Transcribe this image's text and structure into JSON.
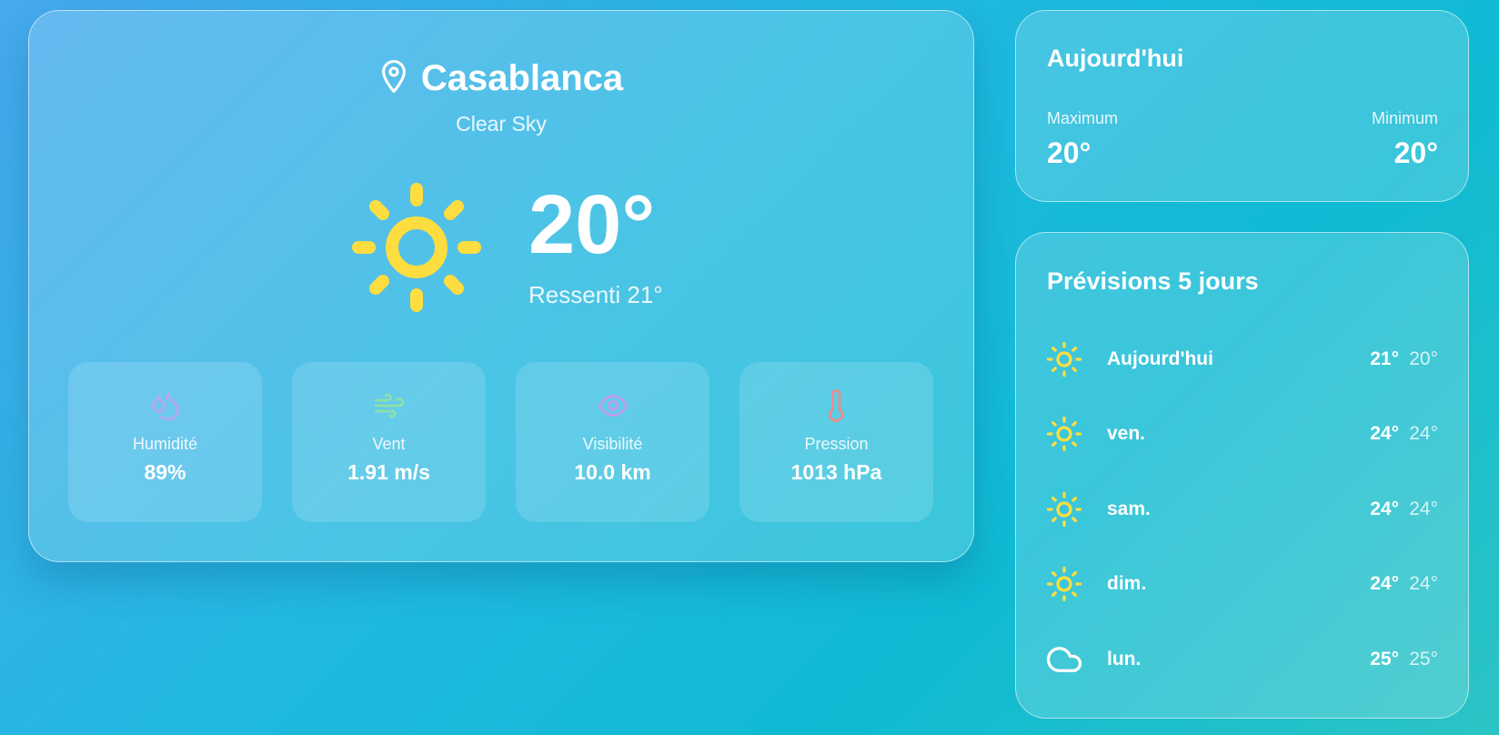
{
  "current": {
    "city": "Casablanca",
    "description": "Clear Sky",
    "temperature": "20°",
    "feels_like": "Ressenti 21°",
    "icon": "sun-icon",
    "stats": [
      {
        "icon": "droplets-icon",
        "color": "#b9a7f0",
        "label": "Humidité",
        "value": "89%"
      },
      {
        "icon": "wind-icon",
        "color": "#8de0a8",
        "label": "Vent",
        "value": "1.91 m/s"
      },
      {
        "icon": "eye-icon",
        "color": "#c39af2",
        "label": "Visibilité",
        "value": "10.0 km"
      },
      {
        "icon": "thermometer-icon",
        "color": "#f08a8a",
        "label": "Pression",
        "value": "1013 hPa"
      }
    ]
  },
  "today": {
    "title": "Aujourd'hui",
    "max_label": "Maximum",
    "max_value": "20°",
    "min_label": "Minimum",
    "min_value": "20°"
  },
  "forecast": {
    "title": "Prévisions 5 jours",
    "days": [
      {
        "icon": "sun-icon",
        "day": "Aujourd'hui",
        "high": "21°",
        "low": "20°"
      },
      {
        "icon": "sun-icon",
        "day": "ven.",
        "high": "24°",
        "low": "24°"
      },
      {
        "icon": "sun-icon",
        "day": "sam.",
        "high": "24°",
        "low": "24°"
      },
      {
        "icon": "sun-icon",
        "day": "dim.",
        "high": "24°",
        "low": "24°"
      },
      {
        "icon": "cloud-icon",
        "day": "lun.",
        "high": "25°",
        "low": "25°"
      }
    ]
  },
  "colors": {
    "sun": "#fddd3f",
    "background_start": "#46a9ee",
    "background_end": "#2cc4c4"
  }
}
